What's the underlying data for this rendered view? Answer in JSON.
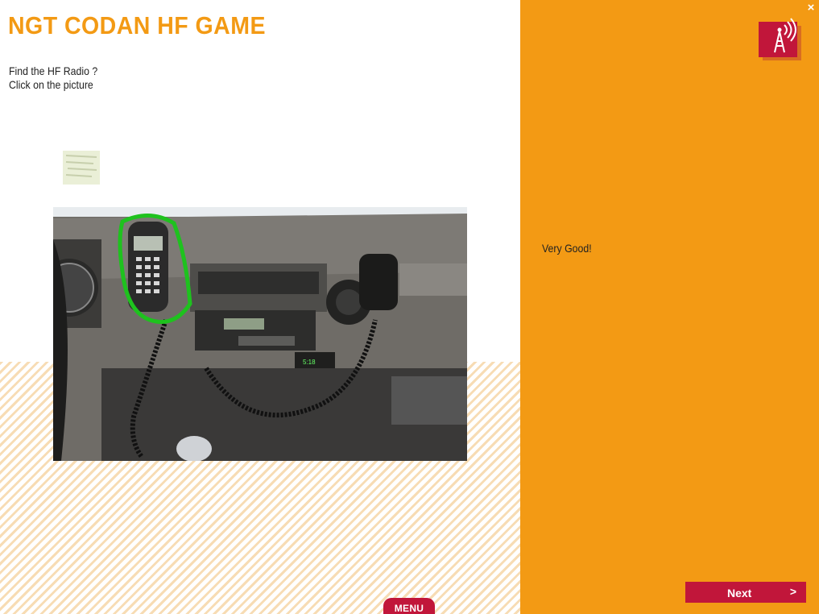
{
  "header": {
    "title": "NGT CODAN HF GAME"
  },
  "instructions": {
    "line1": "Find the HF Radio ?",
    "line2": "Click on the picture"
  },
  "question": {
    "image_icon": "vehicle-dashboard-photo",
    "highlight_color": "#1ec21e"
  },
  "feedback": {
    "text": "Very Good!"
  },
  "navigation": {
    "menu_label": "MENU",
    "next_label": "Next",
    "next_arrow": ">"
  },
  "window": {
    "close_symbol": "×"
  },
  "colors": {
    "accent": "#f39a14",
    "button": "#c1163a",
    "highlight": "#1ec21e"
  }
}
